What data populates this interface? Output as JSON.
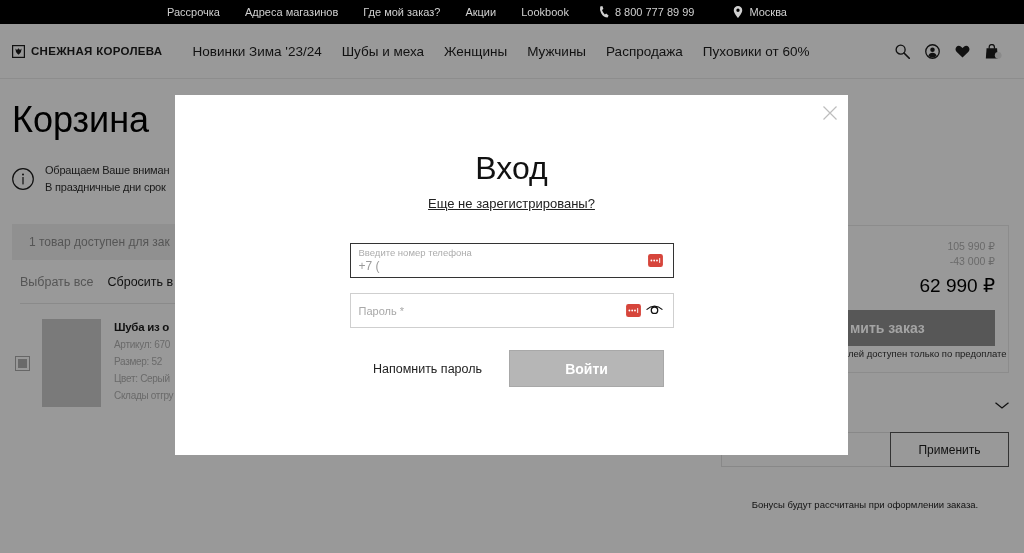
{
  "top_bar": {
    "links": [
      "Рассрочка",
      "Адреса магазинов",
      "Где мой заказ?",
      "Акции",
      "Lookbook"
    ],
    "phone": "8 800 777 89 99",
    "city": "Москва"
  },
  "header": {
    "logo": "СНЕЖНАЯ КОРОЛЕВА",
    "nav": [
      "Новинки Зима '23/24",
      "Шубы и меха",
      "Женщины",
      "Мужчины",
      "Распродажа",
      "Пуховики от 60%"
    ]
  },
  "cart": {
    "title": "Корзина",
    "notice": [
      "Обращаем Ваше вниман",
      "В праздничные дни срок"
    ],
    "availability": "1 товар доступен для зак",
    "select_all": "Выбрать все",
    "reset": "Сбросить в",
    "items": [
      {
        "checked": true,
        "name": "Шуба из о",
        "details": [
          "Артикул: 670",
          "Размер: 52",
          "Цвет: Серый",
          "Склады отгру"
        ]
      }
    ]
  },
  "summary": {
    "subtotal": "105 990 ₽",
    "discount": "-43 000 ₽",
    "total": "62 990 ₽",
    "checkout_button": "мить заказ",
    "checkout_note": "лей доступен только по предоплате"
  },
  "promo": {
    "apply_button": "Применить",
    "bonus_note": "Бонусы будут рассчитаны при оформлении заказа."
  },
  "login_modal": {
    "title": "Вход",
    "register_link": "Еще не зарегистрированы?",
    "phone_field": {
      "label": "Введите номер телефона",
      "value": "+7 (",
      "focused": true
    },
    "password_field": {
      "placeholder": "Пароль *",
      "focused": false
    },
    "remind_link": "Напомнить пароль",
    "login_button": {
      "label": "Войти",
      "disabled": true
    }
  }
}
